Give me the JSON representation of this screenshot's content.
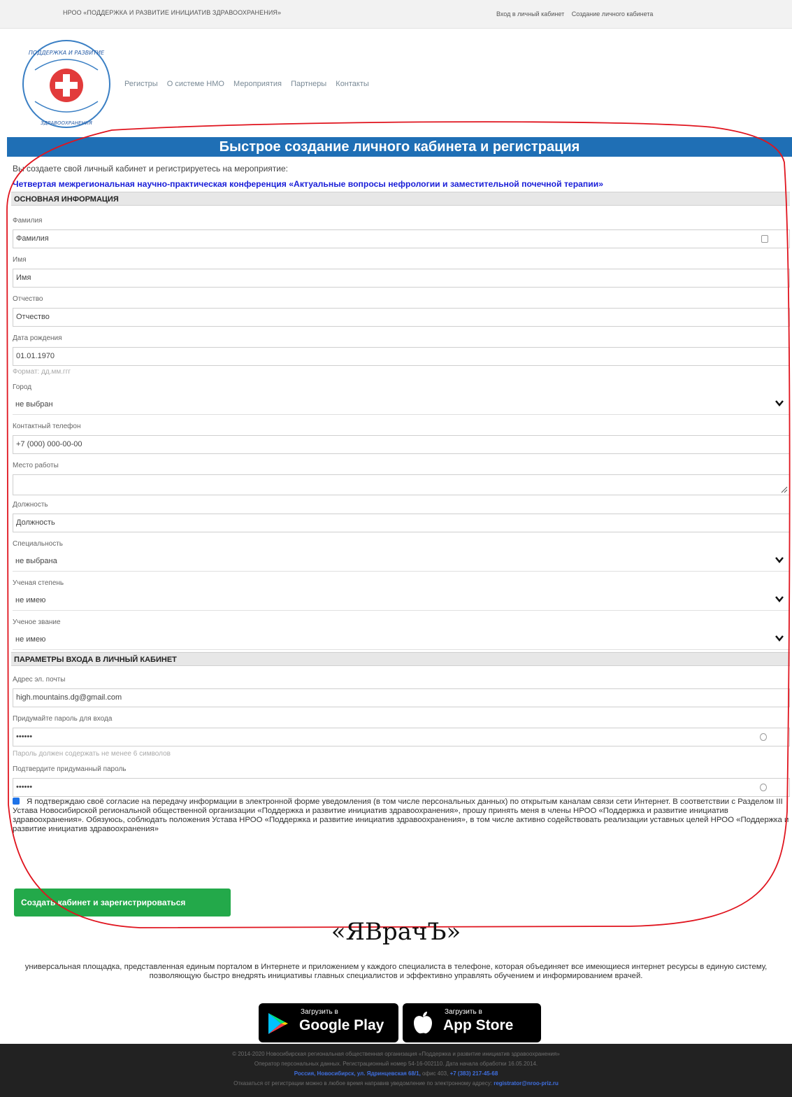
{
  "topbar": {
    "org_name": "НРОО «ПОДДЕРЖКА И РАЗВИТИЕ ИНИЦИАТИВ ЗДРАВООХРАНЕНИЯ»",
    "login_link": "Вход в личный кабинет",
    "create_link": "Создание личного кабинета"
  },
  "nav": {
    "items": [
      "Регистры",
      "О системе НМО",
      "Мероприятия",
      "Партнеры",
      "Контакты"
    ]
  },
  "banner": "Быстрое создание личного кабинета и регистрация",
  "intro": "Вы создаете свой личный кабинет и регистрируетесь на мероприятие:",
  "event_title": "Четвертая межрегиональная научно-практическая конференция «Актуальные вопросы нефрологии и заместительной почечной терапии»",
  "section_main": "ОСНОВНАЯ ИНФОРМАЦИЯ",
  "fields": {
    "surname": {
      "label": "Фамилия",
      "placeholder": "Фамилия"
    },
    "name": {
      "label": "Имя",
      "placeholder": "Имя"
    },
    "patronymic": {
      "label": "Отчество",
      "placeholder": "Отчество"
    },
    "birthdate": {
      "label": "Дата рождения",
      "value": "01.01.1970",
      "hint": "Формат: дд.мм.ггг"
    },
    "city": {
      "label": "Город",
      "value": "не выбран"
    },
    "phone": {
      "label": "Контактный телефон",
      "placeholder": "+7 (000) 000-00-00"
    },
    "workplace": {
      "label": "Место работы",
      "value": ""
    },
    "position": {
      "label": "Должность",
      "placeholder": "Должность"
    },
    "specialty": {
      "label": "Специальность",
      "value": "не выбрана"
    },
    "degree": {
      "label": "Ученая степень",
      "value": "не имею"
    },
    "title": {
      "label": "Ученое звание",
      "value": "не имею"
    }
  },
  "section_login": "ПАРАМЕТРЫ ВХОДА В ЛИЧНЫЙ КАБИНЕТ",
  "login": {
    "email": {
      "label": "Адрес эл. почты",
      "value": "high.mountains.dg@gmail.com"
    },
    "password": {
      "label": "Придумайте пароль для входа",
      "value": "••••••",
      "hint": "Пароль должен содержать не менее 6 символов"
    },
    "confirm": {
      "label": "Подтвердите придуманный пароль",
      "value": "••••••"
    }
  },
  "consent": {
    "checked": true,
    "text": "Я подтверждаю своё согласие на передачу информации в электронной форме уведомления (в том числе персональных данных) по открытым каналам связи сети Интернет. В соответствии с Разделом III Устава Новосибирской региональной общественной организации «Поддержка и развитие инициатив здравоохранения», прошу принять меня в члены НРОО «Поддержка и развитие инициатив здравоохранения». Обязуюсь, соблюдать положения Устава НРОО «Поддержка и развитие инициатив здравоохранения», в том числе активно содействовать реализации уставных целей НРОО «Поддержка и развитие инициатив здравоохранения»"
  },
  "submit_label": "Создать кабинет и зарегистрироваться",
  "brand": {
    "name": "«ЯВрачЪ»",
    "description": "универсальная площадка, представленная единым порталом в Интернете и приложением у каждого специалиста в телефоне, которая объединяет все имеющиеся интернет ресурсы в единую систему, позволяющую быстро внедрять инициативы главных специалистов и эффективно управлять обучением и информированием врачей."
  },
  "stores": {
    "google": {
      "small": "Загрузить в",
      "big": "Google Play"
    },
    "apple": {
      "small": "Загрузить в",
      "big": "App Store"
    }
  },
  "footer": {
    "line1": "© 2014-2020 Новосибирская региональная общественная организация «Поддержка и развитие инициатив здравоохранения»",
    "line2": "Оператор персональных данных. Регистрационный номер 54-16-002110. Дата начала обработки 16.05.2014.",
    "address": "Россия, Новосибирск, ул. Ядринцевская 68/1,",
    "office": " офис 403, ",
    "phone": "+7 (383) 217-45-68",
    "line4": "Отказаться от регистрации можно в любое время направив уведомление по электронному адресу: ",
    "email": "registrator@nroo-priz.ru"
  },
  "colors": {
    "banner": "#1f6fb5",
    "submit": "#23a94a",
    "event_link": "#1a1fd8",
    "annotation": "#e0141e",
    "footer_bg": "#222222"
  }
}
